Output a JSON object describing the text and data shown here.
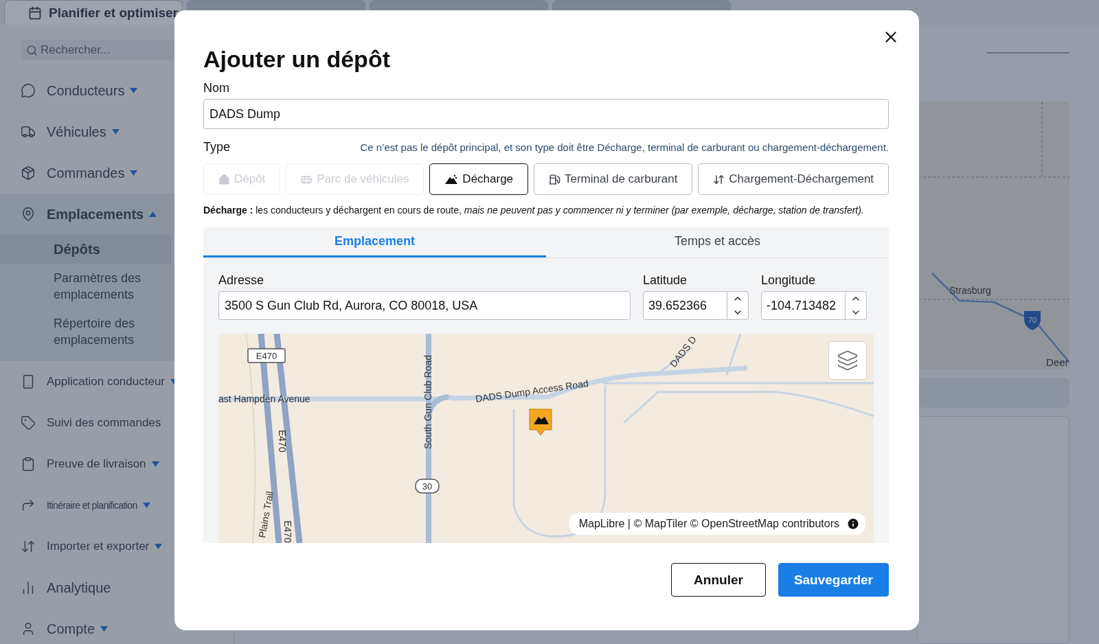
{
  "app_tabs": [
    {
      "label": "Planifier et optimiser",
      "selected": true
    }
  ],
  "sidebar": {
    "search": {
      "placeholder": "Rechercher..."
    },
    "items": [
      {
        "label": "Conducteurs",
        "kind": "menu",
        "expanded": false
      },
      {
        "label": "Véhicules",
        "kind": "menu",
        "expanded": false
      },
      {
        "label": "Commandes",
        "kind": "menu",
        "expanded": false
      },
      {
        "label": "Emplacements",
        "kind": "menu",
        "expanded": true,
        "children": [
          {
            "label": "Dépôts",
            "selected": true
          },
          {
            "label": "Paramètres des emplacements",
            "selected": false
          },
          {
            "label": "Répertoire des emplacements",
            "selected": false
          }
        ]
      },
      {
        "label": "Application conducteur",
        "kind": "menu",
        "expanded": false
      },
      {
        "label": "Suivi des commandes",
        "kind": "link"
      },
      {
        "label": "Preuve de livraison",
        "kind": "menu",
        "expanded": false
      },
      {
        "label": "Itinéraire et planification",
        "kind": "menu",
        "expanded": false
      },
      {
        "label": "Importer et exporter",
        "kind": "menu",
        "expanded": false
      },
      {
        "label": "Analytique",
        "kind": "link"
      },
      {
        "label": "Compte",
        "kind": "menu",
        "expanded": false
      }
    ]
  },
  "background_map": {
    "labels": [
      "Strasburg",
      "Deer"
    ],
    "shield": "70"
  },
  "dialog": {
    "title": "Ajouter un dépôt",
    "name_field": {
      "label": "Nom",
      "value": "DADS Dump"
    },
    "type": {
      "label": "Type",
      "hint": "Ce n’est pas le dépôt principal, et son type doit être Décharge, terminal de carburant ou chargement-déchargement.",
      "options": [
        {
          "label": "Dépôt",
          "selected": false,
          "disabled": true
        },
        {
          "label": "Parc de véhicules",
          "selected": false,
          "disabled": true
        },
        {
          "label": "Décharge",
          "selected": true,
          "disabled": false
        },
        {
          "label": "Terminal de carburant",
          "selected": false,
          "disabled": false
        },
        {
          "label": "Chargement-Déchargement",
          "selected": false,
          "disabled": false
        }
      ],
      "description": "**Décharge :** les conducteurs y déchargent en cours de route, *mais ne peuvent pas y commencer ni y terminer (par exemple, décharge, station de transfert).*"
    },
    "tabs": [
      {
        "label": "Emplacement",
        "selected": true
      },
      {
        "label": "Temps et accès",
        "selected": false
      }
    ],
    "address": {
      "label": "Adresse",
      "value": "3500 S Gun Club Rd, Aurora, CO 80018, USA"
    },
    "latitude": {
      "label": "Latitude",
      "value": "39.652366"
    },
    "longitude": {
      "label": "Longitude",
      "value": "-104.713482"
    },
    "map": {
      "labels": [
        {
          "kind": "shield",
          "text": "E470"
        },
        {
          "kind": "road",
          "text": "ast Hampden Avenue"
        },
        {
          "kind": "road",
          "text": "E470"
        },
        {
          "kind": "road",
          "text": "South Gun Club Road"
        },
        {
          "kind": "shield",
          "text": "30"
        },
        {
          "kind": "road",
          "text": "DADS Dump Access Road"
        },
        {
          "kind": "road",
          "text": "DADS D"
        },
        {
          "kind": "road",
          "text": "Plains Trail"
        },
        {
          "kind": "road",
          "text": "E470"
        }
      ],
      "attribution": "MapLibre | © MapTiler © OpenStreetMap contributors"
    },
    "buttons": [
      {
        "label": "Annuler",
        "kind": "secondary"
      },
      {
        "label": "Sauvegarder",
        "kind": "primary"
      }
    ]
  }
}
